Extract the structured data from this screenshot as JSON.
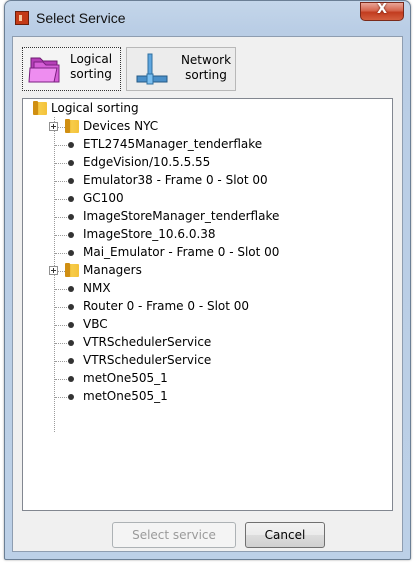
{
  "window": {
    "title": "Select Service",
    "close_glyph": "X"
  },
  "tabs": [
    {
      "label": "Logical\nsorting",
      "icon": "folders-icon",
      "active": true
    },
    {
      "label": "Network\nsorting",
      "icon": "network-icon",
      "active": false
    }
  ],
  "tree": {
    "root": {
      "label": "Logical sorting",
      "icon": "folder-icon"
    },
    "items": [
      {
        "label": "Devices NYC",
        "type": "folder",
        "expandable": true
      },
      {
        "label": "ETL2745Manager_tenderflake",
        "type": "service"
      },
      {
        "label": "EdgeVision/10.5.5.55",
        "type": "service"
      },
      {
        "label": "Emulator38 - Frame 0 - Slot 00",
        "type": "service"
      },
      {
        "label": "GC100",
        "type": "service"
      },
      {
        "label": "ImageStoreManager_tenderflake",
        "type": "service"
      },
      {
        "label": "ImageStore_10.6.0.38",
        "type": "service"
      },
      {
        "label": "Mai_Emulator - Frame 0 - Slot 00",
        "type": "service"
      },
      {
        "label": "Managers",
        "type": "folder",
        "expandable": true
      },
      {
        "label": "NMX",
        "type": "service"
      },
      {
        "label": "Router 0 - Frame 0 - Slot 00",
        "type": "service"
      },
      {
        "label": "VBC",
        "type": "service"
      },
      {
        "label": "VTRSchedulerService",
        "type": "service"
      },
      {
        "label": "VTRSchedulerService",
        "type": "service"
      },
      {
        "label": "metOne505_1",
        "type": "service"
      },
      {
        "label": "metOne505_1",
        "type": "service"
      }
    ]
  },
  "buttons": {
    "select_label": "Select service",
    "select_enabled": false,
    "cancel_label": "Cancel"
  },
  "colors": {
    "title_bar": "#bcd0e7",
    "close_button": "#c23c1f",
    "folder": "#f4c23a"
  }
}
